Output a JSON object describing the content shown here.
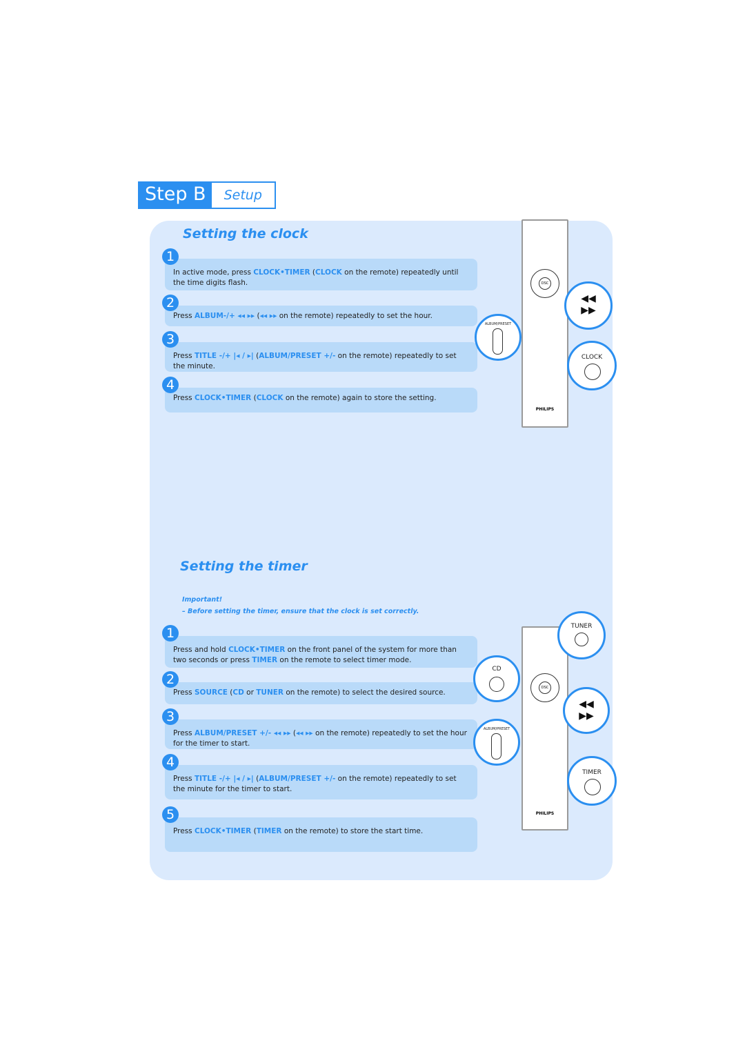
{
  "header": {
    "step": "Step B",
    "subtitle": "Setup"
  },
  "clock": {
    "title": "Setting the clock",
    "steps": [
      {
        "num": "1",
        "parts": [
          "In active mode, press ",
          "CLOCK•TIMER",
          " (",
          "CLOCK",
          "  on the remote) repeatedly until the time digits flash."
        ]
      },
      {
        "num": "2",
        "parts": [
          "Press ",
          "ALBUM-/+ ◂◂  ▸▸",
          " (",
          "◂◂  ▸▸",
          " on the remote) repeatedly to set the hour."
        ]
      },
      {
        "num": "3",
        "parts": [
          "Press ",
          "TITLE -/+  |◂ / ▸|",
          "  (",
          "ALBUM/PRESET +/-",
          "  on the remote) repeatedly to set the minute."
        ]
      },
      {
        "num": "4",
        "parts": [
          "Press ",
          "CLOCK•TIMER",
          " (",
          "CLOCK",
          "  on the remote) again to store the setting."
        ]
      }
    ],
    "callouts": {
      "skip": "◀◀\n▶▶",
      "album_preset": "ALBUM/PRESET",
      "clock": "CLOCK"
    }
  },
  "timer": {
    "title": "Setting the timer",
    "important_label": "Important!",
    "important_text": "–  Before setting the timer, ensure that the clock is set correctly.",
    "steps": [
      {
        "num": "1",
        "parts": [
          "Press and hold ",
          "CLOCK•TIMER",
          " on the front panel of the system for more than two seconds or press ",
          "TIMER",
          " on the remote to select timer mode."
        ]
      },
      {
        "num": "2",
        "parts": [
          "Press ",
          "SOURCE",
          " (",
          "CD",
          " or ",
          "TUNER",
          " on the remote) to select the desired source."
        ]
      },
      {
        "num": "3",
        "parts": [
          "Press ",
          "ALBUM/PRESET +/- ◂◂  ▸▸",
          " (",
          "◂◂  ▸▸",
          " on the remote) repeatedly to set the hour for the timer to start."
        ]
      },
      {
        "num": "4",
        "parts": [
          "Press ",
          "TITLE -/+  |◂ / ▸|",
          "  (",
          "ALBUM/PRESET +/-",
          " on the remote) repeatedly to set the minute for the timer to start."
        ]
      },
      {
        "num": "5",
        "parts": [
          "Press ",
          "CLOCK•TIMER",
          "  (",
          "TIMER",
          " on the remote) to store the start time."
        ]
      }
    ],
    "callouts": {
      "tuner": "TUNER",
      "cd": "CD",
      "album_preset": "ALBUM/PRESET",
      "timer": "TIMER"
    }
  },
  "remote": {
    "brand": "PHILIPS",
    "disc": "DSC"
  }
}
